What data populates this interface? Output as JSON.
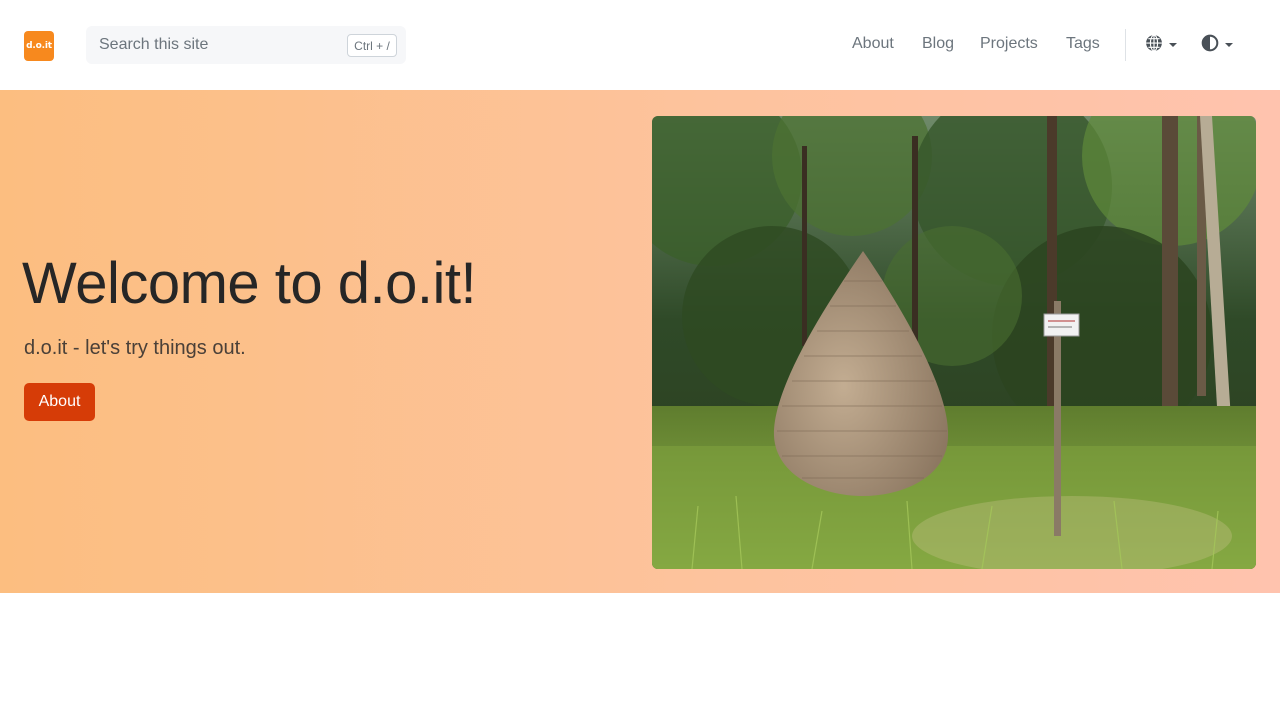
{
  "brand": {
    "logo_text": "d.o.it",
    "color": "#f7891e"
  },
  "search": {
    "placeholder": "Search this site",
    "shortcut": "Ctrl + /"
  },
  "nav": {
    "links": [
      {
        "label": "About"
      },
      {
        "label": "Blog"
      },
      {
        "label": "Projects"
      },
      {
        "label": "Tags"
      }
    ],
    "language_icon": "globe-icon",
    "theme_icon": "half-circle-contrast-icon"
  },
  "hero": {
    "title": "Welcome to d.o.it!",
    "subtitle": "d.o.it - let's try things out.",
    "button_label": "About",
    "button_color": "#d63c07",
    "image_icon": "forest-stone-cone-sculpture-photo"
  }
}
